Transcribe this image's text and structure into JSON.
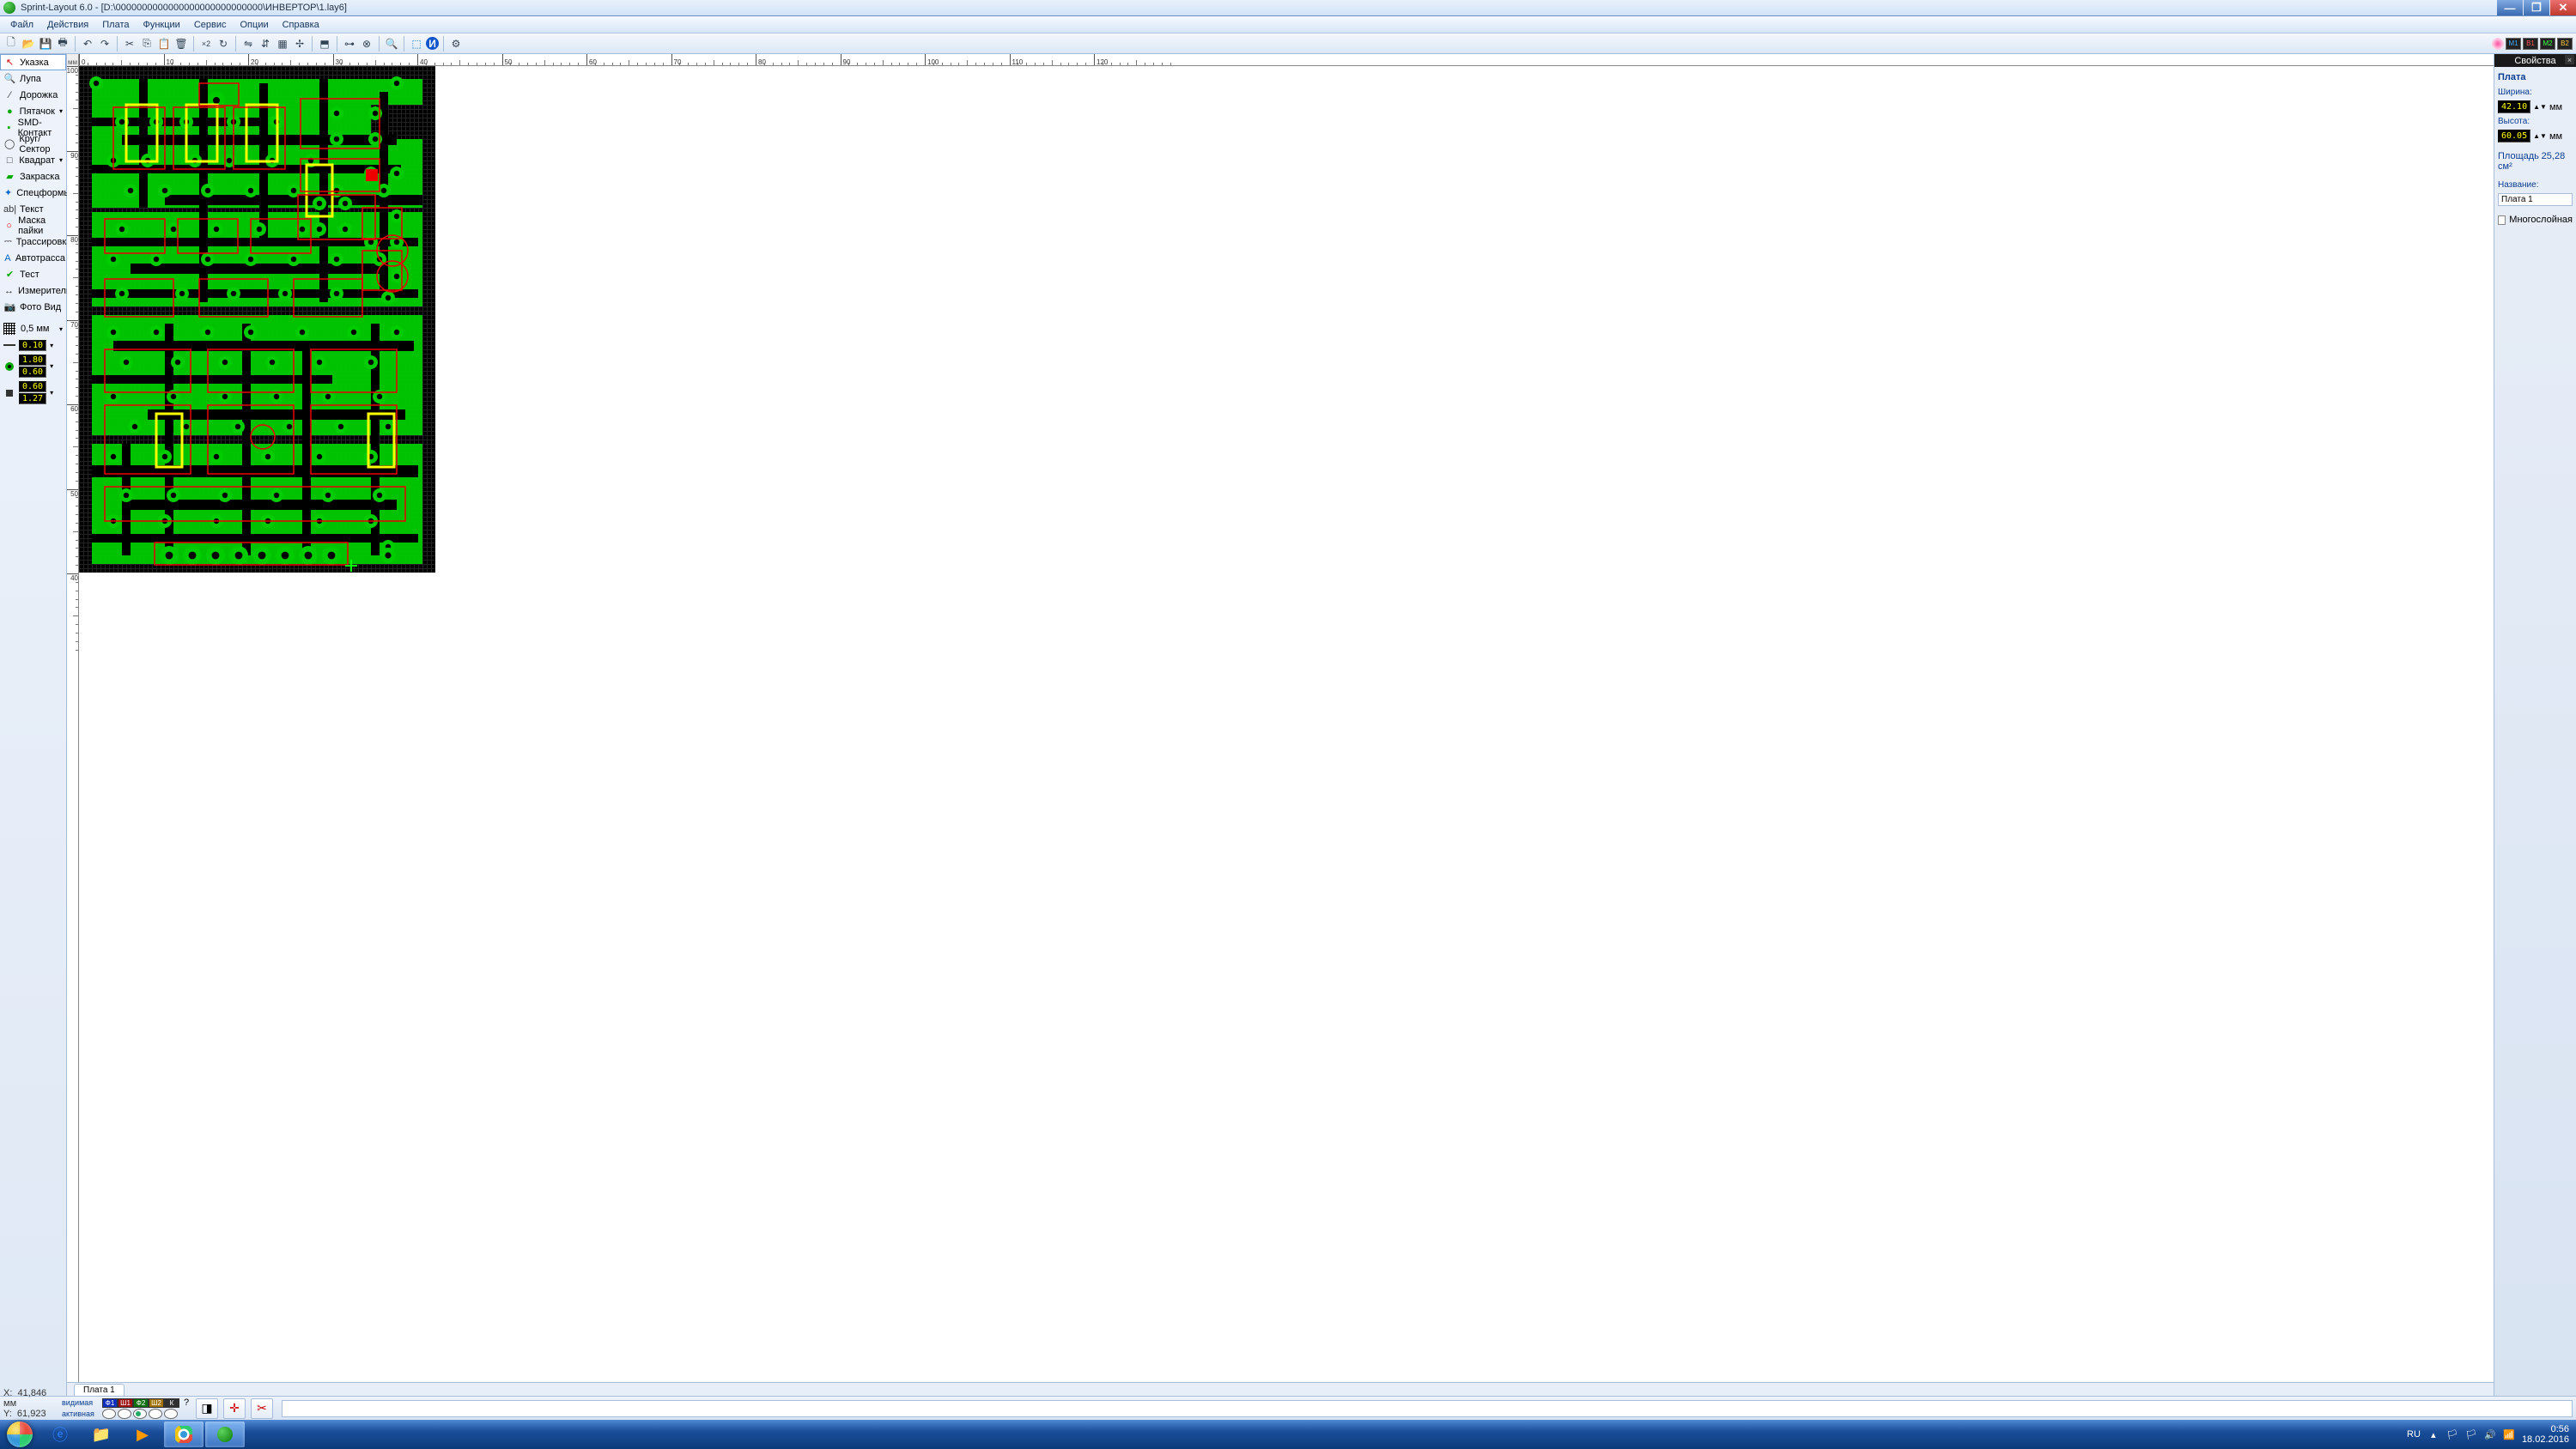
{
  "titlebar": {
    "app": "Sprint-Layout 6.0",
    "file": "[D:\\0000000000000000000000000000\\ИНВЕРТОР\\1.lay6]"
  },
  "menubar": [
    "Файл",
    "Действия",
    "Плата",
    "Функции",
    "Сервис",
    "Опции",
    "Справка"
  ],
  "lefttools": {
    "items": [
      {
        "icon": "↖",
        "label": "Указка",
        "selected": true,
        "iconColor": "#c00"
      },
      {
        "icon": "🔍",
        "label": "Лупа",
        "iconColor": "#333"
      },
      {
        "icon": "∕",
        "label": "Дорожка",
        "iconColor": "#333"
      },
      {
        "icon": "●",
        "label": "Пятачок",
        "iconColor": "#0a0"
      },
      {
        "icon": "▪",
        "label": "SMD-Контакт",
        "iconColor": "#0a0"
      },
      {
        "icon": "◯",
        "label": "Круг/Сектор",
        "iconColor": "#333"
      },
      {
        "icon": "□",
        "label": "Квадрат",
        "iconColor": "#333"
      },
      {
        "icon": "▰",
        "label": "Закраска",
        "iconColor": "#0a0"
      },
      {
        "icon": "✦",
        "label": "Спецформы",
        "iconColor": "#06c"
      },
      {
        "icon": "ab|",
        "label": "Текст",
        "iconColor": "#333"
      },
      {
        "icon": "○",
        "label": "Маска пайки",
        "iconColor": "#e00"
      },
      {
        "icon": "⎓",
        "label": "Трассировка",
        "iconColor": "#333"
      },
      {
        "icon": "A",
        "label": "Автотрасса",
        "iconColor": "#06c"
      },
      {
        "icon": "✔",
        "label": "Тест",
        "iconColor": "#0a0"
      },
      {
        "icon": "↔",
        "label": "Измеритель",
        "iconColor": "#333"
      },
      {
        "icon": "📷",
        "label": "Фото Вид",
        "iconColor": "#333"
      }
    ],
    "grid": "0,5 мм",
    "params": {
      "trackWidth": "0.10",
      "padOuter": "1.80",
      "padInner": "0.60",
      "smdW": "0.60",
      "smdH": "1.27"
    }
  },
  "ruler": {
    "unit": "мм",
    "hTicks": [
      0,
      10,
      20,
      30,
      40,
      50,
      60,
      70,
      80,
      90,
      100,
      110,
      120
    ],
    "vTicks": [
      100,
      90,
      80,
      70,
      60,
      50,
      40
    ]
  },
  "board": {
    "widthPx": 415,
    "heightPx": 590,
    "tab": "Плата 1"
  },
  "props": {
    "header": "Свойства",
    "section": "Плата",
    "widthLbl": "Ширина:",
    "widthVal": "42.10",
    "heightLbl": "Высота:",
    "heightVal": "60.05",
    "unit": "мм",
    "areaLbl": "Площадь",
    "areaVal": "25,28 см²",
    "nameLbl": "Название:",
    "nameVal": "Плата 1",
    "multiLbl": "Многослойная"
  },
  "status": {
    "x": "41,846 мм",
    "y": "61,923 мм",
    "xLbl": "X:",
    "yLbl": "Y:",
    "visibleLbl": "видимая",
    "activeLbl": "активная",
    "layers": [
      {
        "name": "Ф1",
        "bg": "#1030c0"
      },
      {
        "name": "Ш1",
        "bg": "#a01010"
      },
      {
        "name": "Ф2",
        "bg": "#107010"
      },
      {
        "name": "Ш2",
        "bg": "#a07000"
      },
      {
        "name": "К",
        "bg": "#303030"
      }
    ]
  },
  "taskbar": {
    "lang": "RU",
    "time": "0:56",
    "date": "18.02.2016"
  }
}
